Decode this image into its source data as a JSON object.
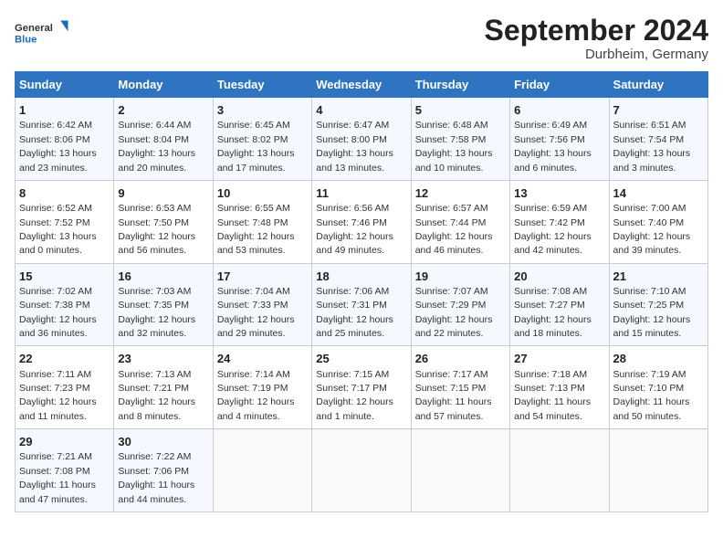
{
  "header": {
    "logo_general": "General",
    "logo_blue": "Blue",
    "month_title": "September 2024",
    "location": "Durbheim, Germany"
  },
  "columns": [
    "Sunday",
    "Monday",
    "Tuesday",
    "Wednesday",
    "Thursday",
    "Friday",
    "Saturday"
  ],
  "weeks": [
    [
      {
        "day": "1",
        "info": "Sunrise: 6:42 AM\nSunset: 8:06 PM\nDaylight: 13 hours\nand 23 minutes."
      },
      {
        "day": "2",
        "info": "Sunrise: 6:44 AM\nSunset: 8:04 PM\nDaylight: 13 hours\nand 20 minutes."
      },
      {
        "day": "3",
        "info": "Sunrise: 6:45 AM\nSunset: 8:02 PM\nDaylight: 13 hours\nand 17 minutes."
      },
      {
        "day": "4",
        "info": "Sunrise: 6:47 AM\nSunset: 8:00 PM\nDaylight: 13 hours\nand 13 minutes."
      },
      {
        "day": "5",
        "info": "Sunrise: 6:48 AM\nSunset: 7:58 PM\nDaylight: 13 hours\nand 10 minutes."
      },
      {
        "day": "6",
        "info": "Sunrise: 6:49 AM\nSunset: 7:56 PM\nDaylight: 13 hours\nand 6 minutes."
      },
      {
        "day": "7",
        "info": "Sunrise: 6:51 AM\nSunset: 7:54 PM\nDaylight: 13 hours\nand 3 minutes."
      }
    ],
    [
      {
        "day": "8",
        "info": "Sunrise: 6:52 AM\nSunset: 7:52 PM\nDaylight: 13 hours\nand 0 minutes."
      },
      {
        "day": "9",
        "info": "Sunrise: 6:53 AM\nSunset: 7:50 PM\nDaylight: 12 hours\nand 56 minutes."
      },
      {
        "day": "10",
        "info": "Sunrise: 6:55 AM\nSunset: 7:48 PM\nDaylight: 12 hours\nand 53 minutes."
      },
      {
        "day": "11",
        "info": "Sunrise: 6:56 AM\nSunset: 7:46 PM\nDaylight: 12 hours\nand 49 minutes."
      },
      {
        "day": "12",
        "info": "Sunrise: 6:57 AM\nSunset: 7:44 PM\nDaylight: 12 hours\nand 46 minutes."
      },
      {
        "day": "13",
        "info": "Sunrise: 6:59 AM\nSunset: 7:42 PM\nDaylight: 12 hours\nand 42 minutes."
      },
      {
        "day": "14",
        "info": "Sunrise: 7:00 AM\nSunset: 7:40 PM\nDaylight: 12 hours\nand 39 minutes."
      }
    ],
    [
      {
        "day": "15",
        "info": "Sunrise: 7:02 AM\nSunset: 7:38 PM\nDaylight: 12 hours\nand 36 minutes."
      },
      {
        "day": "16",
        "info": "Sunrise: 7:03 AM\nSunset: 7:35 PM\nDaylight: 12 hours\nand 32 minutes."
      },
      {
        "day": "17",
        "info": "Sunrise: 7:04 AM\nSunset: 7:33 PM\nDaylight: 12 hours\nand 29 minutes."
      },
      {
        "day": "18",
        "info": "Sunrise: 7:06 AM\nSunset: 7:31 PM\nDaylight: 12 hours\nand 25 minutes."
      },
      {
        "day": "19",
        "info": "Sunrise: 7:07 AM\nSunset: 7:29 PM\nDaylight: 12 hours\nand 22 minutes."
      },
      {
        "day": "20",
        "info": "Sunrise: 7:08 AM\nSunset: 7:27 PM\nDaylight: 12 hours\nand 18 minutes."
      },
      {
        "day": "21",
        "info": "Sunrise: 7:10 AM\nSunset: 7:25 PM\nDaylight: 12 hours\nand 15 minutes."
      }
    ],
    [
      {
        "day": "22",
        "info": "Sunrise: 7:11 AM\nSunset: 7:23 PM\nDaylight: 12 hours\nand 11 minutes."
      },
      {
        "day": "23",
        "info": "Sunrise: 7:13 AM\nSunset: 7:21 PM\nDaylight: 12 hours\nand 8 minutes."
      },
      {
        "day": "24",
        "info": "Sunrise: 7:14 AM\nSunset: 7:19 PM\nDaylight: 12 hours\nand 4 minutes."
      },
      {
        "day": "25",
        "info": "Sunrise: 7:15 AM\nSunset: 7:17 PM\nDaylight: 12 hours\nand 1 minute."
      },
      {
        "day": "26",
        "info": "Sunrise: 7:17 AM\nSunset: 7:15 PM\nDaylight: 11 hours\nand 57 minutes."
      },
      {
        "day": "27",
        "info": "Sunrise: 7:18 AM\nSunset: 7:13 PM\nDaylight: 11 hours\nand 54 minutes."
      },
      {
        "day": "28",
        "info": "Sunrise: 7:19 AM\nSunset: 7:10 PM\nDaylight: 11 hours\nand 50 minutes."
      }
    ],
    [
      {
        "day": "29",
        "info": "Sunrise: 7:21 AM\nSunset: 7:08 PM\nDaylight: 11 hours\nand 47 minutes."
      },
      {
        "day": "30",
        "info": "Sunrise: 7:22 AM\nSunset: 7:06 PM\nDaylight: 11 hours\nand 44 minutes."
      },
      {
        "day": "",
        "info": ""
      },
      {
        "day": "",
        "info": ""
      },
      {
        "day": "",
        "info": ""
      },
      {
        "day": "",
        "info": ""
      },
      {
        "day": "",
        "info": ""
      }
    ]
  ]
}
